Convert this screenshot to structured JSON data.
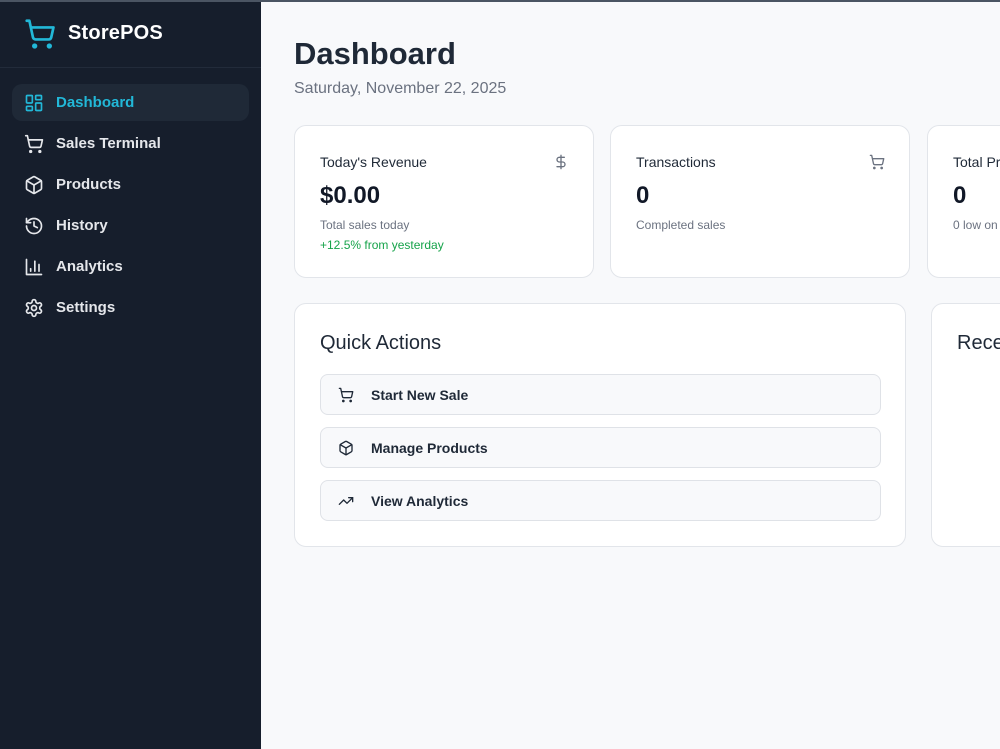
{
  "app": {
    "name": "StorePOS",
    "logo_icon": "shopping-cart-icon",
    "accent": "#22b8d8"
  },
  "sidebar": {
    "items": [
      {
        "label": "Dashboard",
        "icon": "layout-grid-icon",
        "active": true
      },
      {
        "label": "Sales Terminal",
        "icon": "shopping-cart-icon"
      },
      {
        "label": "Products",
        "icon": "package-icon"
      },
      {
        "label": "History",
        "icon": "history-icon"
      },
      {
        "label": "Analytics",
        "icon": "bar-chart-icon"
      },
      {
        "label": "Settings",
        "icon": "gear-icon"
      }
    ]
  },
  "header": {
    "title": "Dashboard",
    "date": "Saturday, November 22, 2025"
  },
  "stats": [
    {
      "title": "Today's Revenue",
      "value": "$0.00",
      "sub": "Total sales today",
      "trend": "+12.5% from yesterday",
      "icon": "dollar-icon",
      "trend_color": "#16a34a"
    },
    {
      "title": "Transactions",
      "value": "0",
      "sub": "Completed sales",
      "icon": "shopping-cart-icon"
    },
    {
      "title": "Total Pr",
      "value": "0",
      "sub": "0 low on"
    }
  ],
  "quick_actions": {
    "title": "Quick Actions",
    "buttons": [
      {
        "label": "Start New Sale",
        "icon": "shopping-cart-icon"
      },
      {
        "label": "Manage Products",
        "icon": "package-icon"
      },
      {
        "label": "View Analytics",
        "icon": "trending-up-icon"
      }
    ]
  },
  "recent": {
    "title": "Rece"
  }
}
